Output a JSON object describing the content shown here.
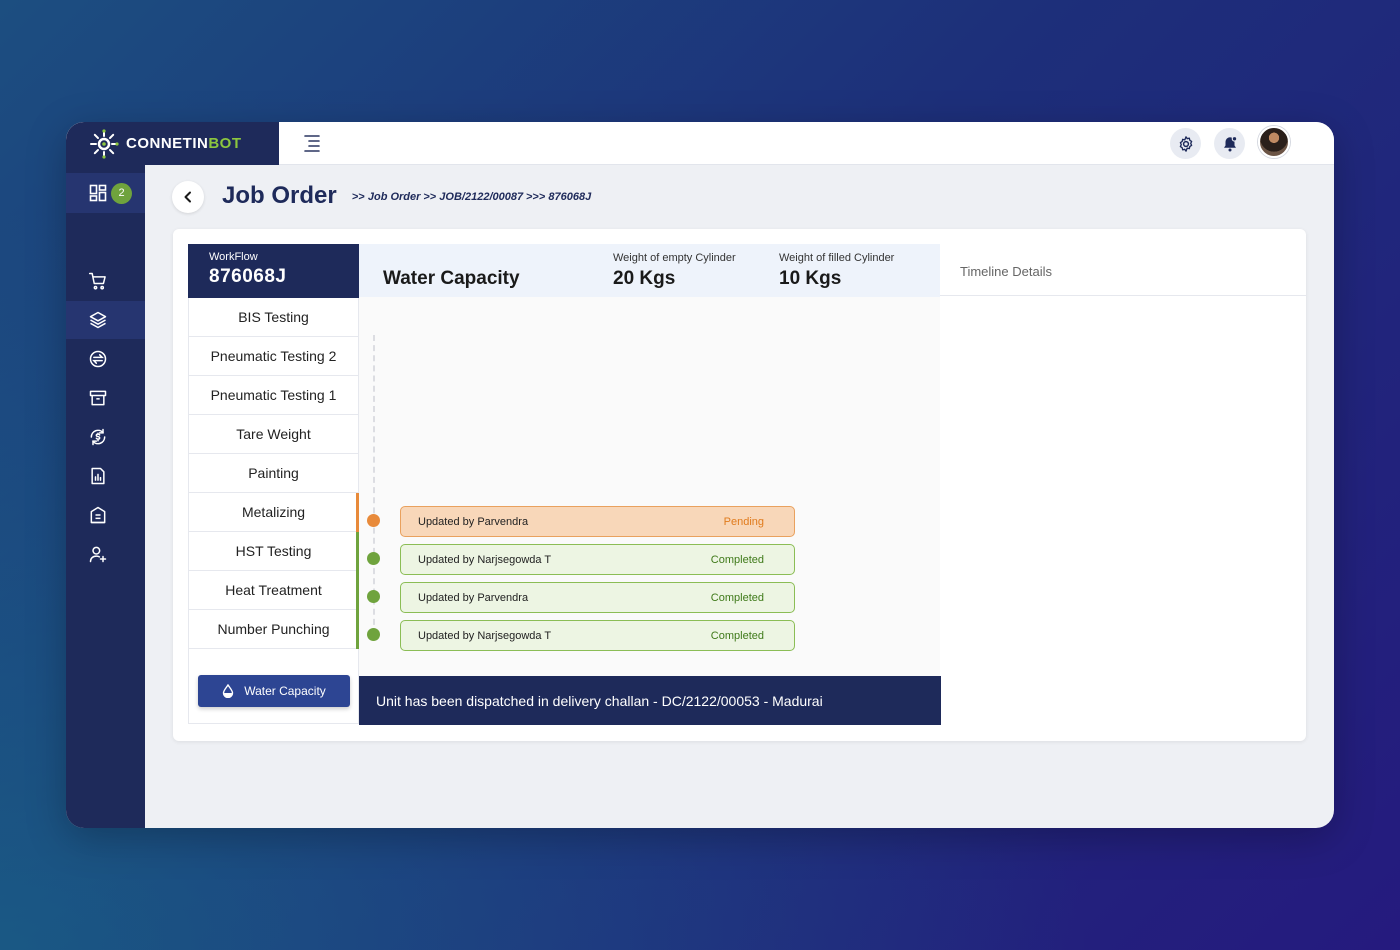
{
  "brand": {
    "name_main": "CONNETIN",
    "name_accent": "BOT"
  },
  "header_icons": [
    "settings-icon",
    "notification-bell-icon",
    "user-avatar"
  ],
  "sidebar": {
    "dashboard_badge": "2",
    "items": [
      {
        "icon": "cart-icon",
        "active": false
      },
      {
        "icon": "layers-icon",
        "active": true
      },
      {
        "icon": "exchange-icon",
        "active": false
      },
      {
        "icon": "archive-icon",
        "active": false
      },
      {
        "icon": "currency-cycle-icon",
        "active": false
      },
      {
        "icon": "report-icon",
        "active": false
      },
      {
        "icon": "building-icon",
        "active": false
      },
      {
        "icon": "add-user-icon",
        "active": false
      }
    ]
  },
  "page": {
    "title": "Job Order",
    "breadcrumb": {
      "sep1": ">>",
      "crumb1": "Job Order",
      "sep2": ">>",
      "crumb2": "JOB/2122/00087",
      "sep3": ">>>",
      "crumb3": "876068J"
    }
  },
  "workflow": {
    "label": "WorkFlow",
    "id": "876068J",
    "steps": [
      {
        "label": "BIS Testing",
        "status": "none"
      },
      {
        "label": "Pneumatic Testing 2",
        "status": "none"
      },
      {
        "label": "Pneumatic Testing 1",
        "status": "none"
      },
      {
        "label": "Tare Weight",
        "status": "none"
      },
      {
        "label": "Painting",
        "status": "none"
      },
      {
        "label": "Metalizing",
        "status": "pending"
      },
      {
        "label": "HST Testing",
        "status": "completed"
      },
      {
        "label": "Heat Treatment",
        "status": "completed"
      },
      {
        "label": "Number Punching",
        "status": "completed"
      }
    ],
    "current_button": "Water Capacity"
  },
  "detail": {
    "title": "Water Capacity",
    "empty_weight_label": "Weight of empty Cylinder",
    "empty_weight_value": "20 Kgs",
    "filled_weight_label": "Weight of filled Cylinder",
    "filled_weight_value": "10 Kgs",
    "logs": [
      {
        "text": "Updated by Parvendra",
        "status": "Pending",
        "kind": "pending"
      },
      {
        "text": "Updated by Narjsegowda T",
        "status": "Completed",
        "kind": "done"
      },
      {
        "text": "Updated by Parvendra",
        "status": "Completed",
        "kind": "done"
      },
      {
        "text": "Updated by Narjsegowda T",
        "status": "Completed",
        "kind": "done"
      }
    ],
    "dispatch_note": "Unit has been dispatched in delivery challan - DC/2122/00053 - Madurai"
  },
  "timeline": {
    "title": "Timeline Details"
  },
  "colors": {
    "navy": "#1e2a5a",
    "accent_green": "#8cc63f",
    "pending": "#e88a3a",
    "completed": "#6fa33d",
    "button_blue": "#2d4593"
  }
}
